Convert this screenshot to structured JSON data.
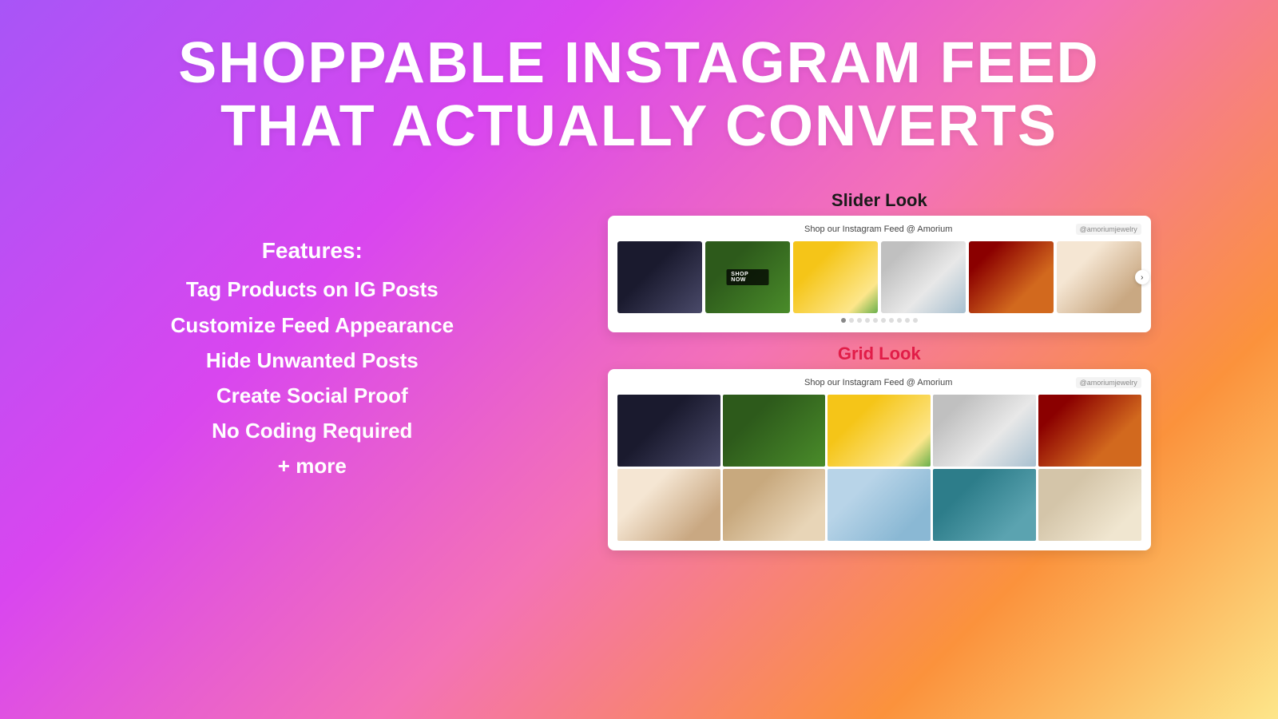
{
  "headline": {
    "line1": "SHOPPABLE INSTAGRAM FEED",
    "line2": "THAT ACTUALLY CONVERTS"
  },
  "features": {
    "title": "Features:",
    "items": [
      "Tag Products on IG Posts",
      "Customize Feed Appearance",
      "Hide Unwanted Posts",
      "Create Social Proof",
      "No Coding Required",
      "+ more"
    ]
  },
  "slider_section": {
    "label": "Slider Look",
    "feed_title": "Shop our Instagram Feed @ Amorium",
    "ig_handle": "@amoriumjewelry",
    "shop_now": "SHOP NOW",
    "arrow": "›",
    "dots_count": 10
  },
  "grid_section": {
    "label": "Grid Look",
    "feed_title": "Shop our Instagram Feed @ Amorium",
    "ig_handle": "@amoriumjewelry"
  }
}
